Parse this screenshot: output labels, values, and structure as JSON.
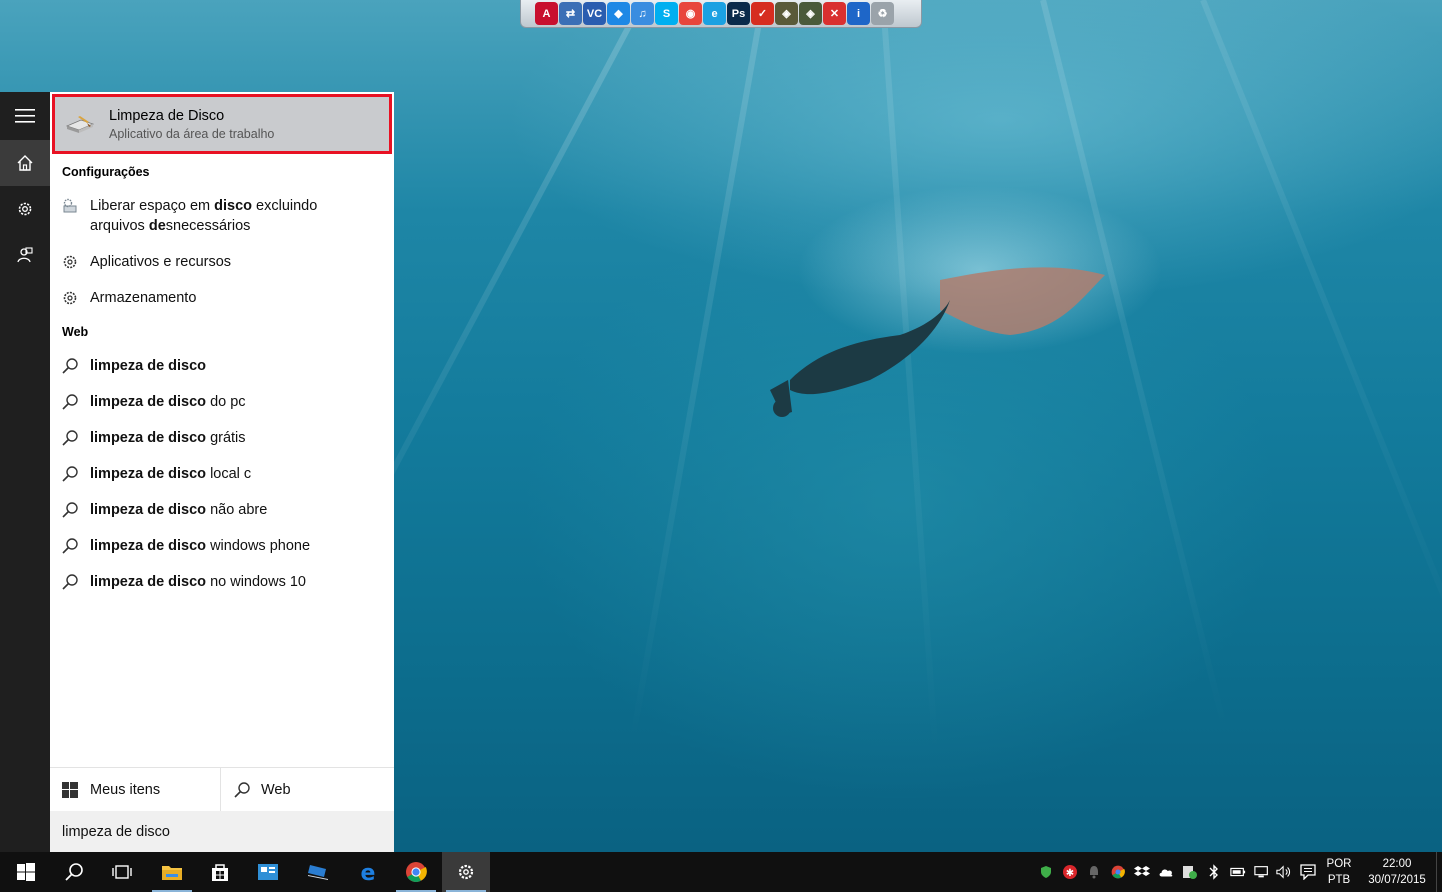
{
  "dock": {
    "icons": [
      {
        "name": "acrobat-icon",
        "color": "#c8102e",
        "glyph": "A"
      },
      {
        "name": "network-icon",
        "color": "#3b6fb6",
        "glyph": "⇄"
      },
      {
        "name": "vc-icon",
        "color": "#2a5db0",
        "glyph": "VC"
      },
      {
        "name": "dropbox-icon",
        "color": "#1e88e5",
        "glyph": "◆"
      },
      {
        "name": "itunes-icon",
        "color": "#3a8de0",
        "glyph": "♫"
      },
      {
        "name": "skype-icon",
        "color": "#00aff0",
        "glyph": "S"
      },
      {
        "name": "chrome-icon",
        "color": "#e8453c",
        "glyph": "◉"
      },
      {
        "name": "ie-icon",
        "color": "#1ba1e2",
        "glyph": "e"
      },
      {
        "name": "photoshop-icon",
        "color": "#0b2a4a",
        "glyph": "Ps"
      },
      {
        "name": "ccleaner-icon",
        "color": "#d62d20",
        "glyph": "✓"
      },
      {
        "name": "tool-icon",
        "color": "#5a5a3a",
        "glyph": "◈"
      },
      {
        "name": "tool2-icon",
        "color": "#4a5a3a",
        "glyph": "◈"
      },
      {
        "name": "delete-icon",
        "color": "#d93030",
        "glyph": "✕"
      },
      {
        "name": "info-icon",
        "color": "#1e66c8",
        "glyph": "i"
      },
      {
        "name": "recycle-bin-icon",
        "color": "#9aa3aa",
        "glyph": "♻"
      }
    ]
  },
  "rail": {
    "menu_icon": "hamburger-icon",
    "home_icon": "home-icon",
    "settings_icon": "gear-icon",
    "feedback_icon": "feedback-icon"
  },
  "best_match": {
    "title": "Limpeza de Disco",
    "subtitle": "Aplicativo da área de trabalho",
    "icon": "disk-cleanup-icon"
  },
  "settings_section": {
    "header": "Configurações",
    "items": [
      {
        "bold": "",
        "pre": "Liberar espaço em ",
        "match": "disco",
        "post": " excluindo",
        "line2_pre": "arquivos ",
        "line2_match": "de",
        "line2_post": "snecessários",
        "icon": "disk-settings-icon"
      },
      {
        "text": "Aplicativos e recursos",
        "icon": "gear-icon"
      },
      {
        "text": "Armazenamento",
        "icon": "gear-icon"
      }
    ]
  },
  "web_section": {
    "header": "Web",
    "items": [
      {
        "match": "limpeza de disco",
        "rest": ""
      },
      {
        "match": "limpeza de disco",
        "rest": " do pc"
      },
      {
        "match": "limpeza de disco",
        "rest": " grátis"
      },
      {
        "match": "limpeza de disco",
        "rest": " local c"
      },
      {
        "match": "limpeza de disco",
        "rest": " não abre"
      },
      {
        "match": "limpeza de disco",
        "rest": " windows phone"
      },
      {
        "match": "limpeza de disco",
        "rest": " no windows 10"
      }
    ]
  },
  "scopes": {
    "mine": "Meus itens",
    "web": "Web"
  },
  "search": {
    "query": "limpeza de disco"
  },
  "taskbar": {
    "lang_line1": "POR",
    "lang_line2": "PTB",
    "time": "22:00",
    "date": "30/07/2015"
  },
  "colors": {
    "highlight_border": "#e81123",
    "taskbar": "#101010",
    "rail": "#1f1f1f"
  }
}
